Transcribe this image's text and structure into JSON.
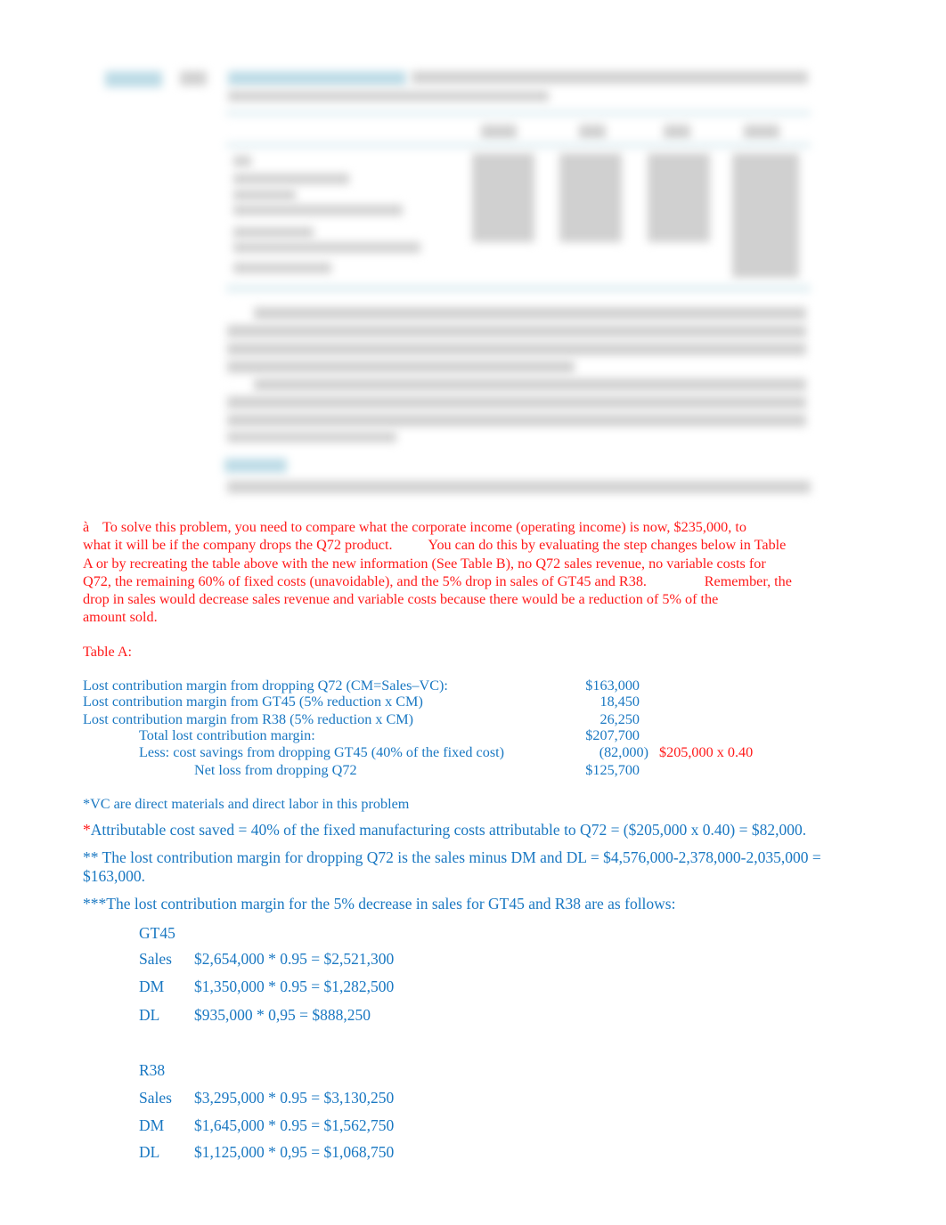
{
  "blurred_section": {
    "note_visible": false
  },
  "intro": {
    "bullet_glyph": "à",
    "lines": [
      "To solve this problem, you need to compare what the corporate income (operating income) is now, $235,000, to",
      "what it will be if the company drops the Q72 product.          You can do this by evaluating the step changes below in Table",
      "A or by recreating the table above with the new information (See Table B), no Q72 sales revenue, no variable costs for",
      "Q72, the remaining 60% of fixed costs (unavoidable), and the 5% drop in sales of GT45 and R38.                Remember, the",
      "drop in sales would decrease sales revenue and variable costs because there would be a reduction of 5% of the",
      "amount sold."
    ]
  },
  "table_a": {
    "title": "Table A:",
    "rows": [
      {
        "label": "Lost contribution margin from dropping Q72 (CM=Sales–VC):",
        "value": "$163,000",
        "note": ""
      },
      {
        "label": "Lost contribution margin from GT45 (5% reduction x CM)",
        "value": "18,450",
        "note": ""
      },
      {
        "label": "Lost contribution margin from R38 (5% reduction x CM)",
        "value": "26,250",
        "note": ""
      },
      {
        "label": "Total lost contribution margin:",
        "value": "$207,700",
        "note": ""
      },
      {
        "label": "Less: cost savings from dropping GT45 (40% of the fixed cost)",
        "value": "(82,000)",
        "note": "$205,000 x 0.40"
      },
      {
        "label": "Net loss from dropping Q72",
        "value": "$125,700",
        "note": ""
      }
    ]
  },
  "notes": {
    "vc": "*VC are direct materials and direct labor in this problem",
    "attributable_star": "*",
    "attributable": "Attributable cost saved = 40% of the fixed manufacturing costs attributable to Q72 = ($205,000 x 0.40) = $82,000.",
    "lost_cm_line1": "** The lost contribution margin for dropping Q72 is the sales minus DM and DL = $4,576,000-2,378,000-2,035,000 =",
    "lost_cm_line2": "$163,000.",
    "decrease": "***The lost contribution margin for the 5% decrease in sales for GT45 and R38 are as follows:"
  },
  "products": [
    {
      "name": "GT45",
      "rows": [
        {
          "label": "Sales",
          "calc": "$2,654,000 * 0.95 = $2,521,300"
        },
        {
          "label": "DM",
          "calc": "$1,350,000 * 0.95 = $1,282,500"
        },
        {
          "label": "DL",
          "calc": "$935,000 * 0,95 = $888,250"
        }
      ]
    },
    {
      "name": "R38",
      "rows": [
        {
          "label": "Sales",
          "calc": "$3,295,000 * 0.95 = $3,130,250"
        },
        {
          "label": "DM",
          "calc": "$1,645,000 * 0.95 = $1,562,750"
        },
        {
          "label": "DL",
          "calc": "$1,125,000 * 0,95 = $1,068,750"
        }
      ]
    }
  ]
}
